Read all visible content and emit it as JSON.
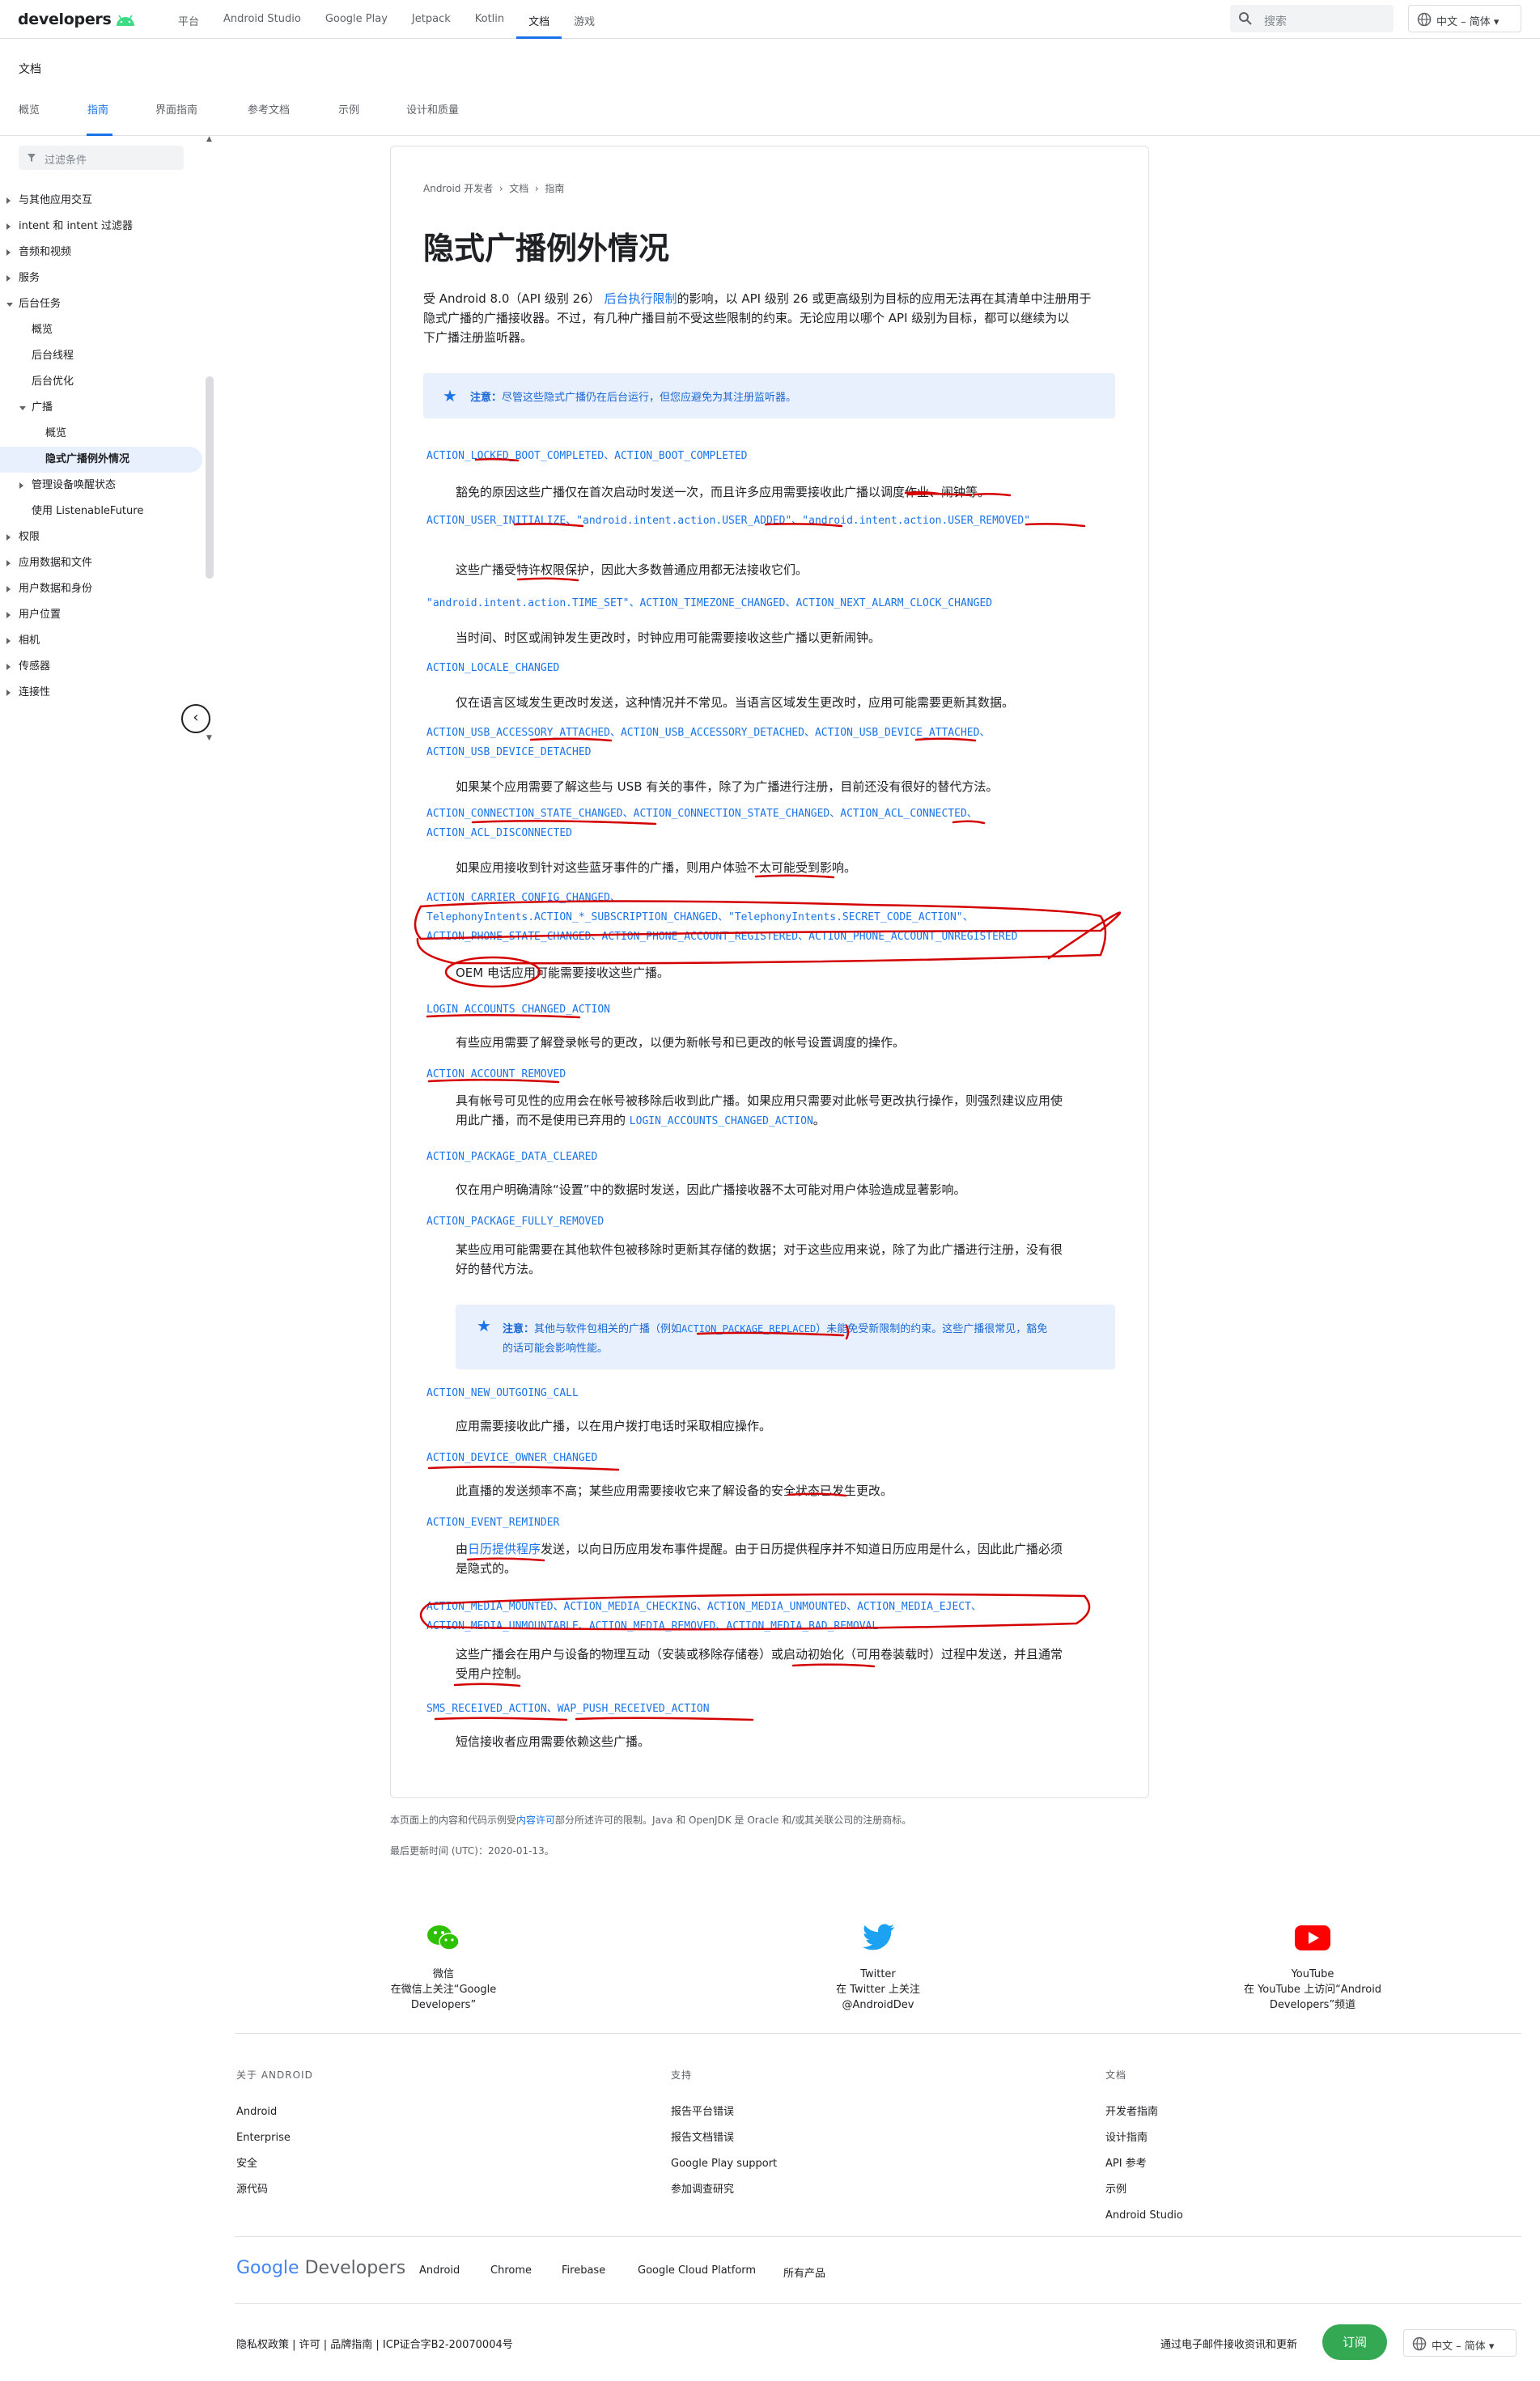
{
  "header": {
    "logo": "developers",
    "nav": [
      "平台",
      "Android Studio",
      "Google Play",
      "Jetpack",
      "Kotlin",
      "文档",
      "游戏"
    ],
    "active_nav": "文档",
    "search_placeholder": "搜索",
    "language": "中文 – 简体"
  },
  "subheader": {
    "title": "文档",
    "tabs": [
      "概览",
      "指南",
      "界面指南",
      "参考文档",
      "示例",
      "设计和质量"
    ],
    "active_tab": "指南"
  },
  "sidebar": {
    "filter_placeholder": "过滤条件",
    "items": [
      {
        "label": "与其他应用交互",
        "level": 0,
        "arrow": "closed"
      },
      {
        "label": "intent 和 intent 过滤器",
        "level": 0,
        "arrow": "closed"
      },
      {
        "label": "音频和视频",
        "level": 0,
        "arrow": "closed"
      },
      {
        "label": "服务",
        "level": 0,
        "arrow": "closed"
      },
      {
        "label": "后台任务",
        "level": 0,
        "arrow": "open"
      },
      {
        "label": "概览",
        "level": 1,
        "arrow": "none"
      },
      {
        "label": "后台线程",
        "level": 1,
        "arrow": "none"
      },
      {
        "label": "后台优化",
        "level": 1,
        "arrow": "none"
      },
      {
        "label": "广播",
        "level": 1,
        "arrow": "open"
      },
      {
        "label": "概览",
        "level": 2,
        "arrow": "none"
      },
      {
        "label": "隐式广播例外情况",
        "level": 2,
        "arrow": "none",
        "selected": true
      },
      {
        "label": "管理设备唤醒状态",
        "level": 1,
        "arrow": "closed"
      },
      {
        "label": "使用 ListenableFuture",
        "level": 1,
        "arrow": "none"
      },
      {
        "label": "权限",
        "level": 0,
        "arrow": "closed"
      },
      {
        "label": "应用数据和文件",
        "level": 0,
        "arrow": "closed"
      },
      {
        "label": "用户数据和身份",
        "level": 0,
        "arrow": "closed"
      },
      {
        "label": "用户位置",
        "level": 0,
        "arrow": "closed"
      },
      {
        "label": "相机",
        "level": 0,
        "arrow": "closed"
      },
      {
        "label": "传感器",
        "level": 0,
        "arrow": "closed"
      },
      {
        "label": "连接性",
        "level": 0,
        "arrow": "closed"
      }
    ]
  },
  "article": {
    "breadcrumb": [
      "Android 开发者",
      "文档",
      "指南"
    ],
    "title": "隐式广播例外情况",
    "intro_1": "受 Android 8.0（API 级别 26）",
    "intro_link": "后台执行限制",
    "intro_2": "的影响，以 API 级别 26 或更高级别为目标的应用无法再在其清单中注册用于",
    "intro_line2": "隐式广播的广播接收器。不过，有几种广播目前不受这些限制的约束。无论应用以哪个 API 级别为目标，都可以继续为以",
    "intro_line3": "下广播注册监听器。",
    "note_label": "注意：",
    "note_text": "尽管这些隐式广播仍在后台运行，但您应避免为其注册监听器。",
    "entries": [
      {
        "codes": "ACTION_LOCKED_BOOT_COMPLETED、ACTION_BOOT_COMPLETED",
        "desc": "豁免的原因这些广播仅在首次启动时发送一次，而且许多应用需要接收此广播以调度作业、闹钟等。"
      },
      {
        "codes": "ACTION_USER_INITIALIZE、\"android.intent.action.USER_ADDED\"、\"android.intent.action.USER_REMOVED\"",
        "desc": "这些广播受特许权限保护，因此大多数普通应用都无法接收它们。"
      },
      {
        "codes": "\"android.intent.action.TIME_SET\"、ACTION_TIMEZONE_CHANGED、ACTION_NEXT_ALARM_CLOCK_CHANGED",
        "desc": "当时间、时区或闹钟发生更改时，时钟应用可能需要接收这些广播以更新闹钟。"
      },
      {
        "codes": "ACTION_LOCALE_CHANGED",
        "desc": "仅在语言区域发生更改时发送，这种情况并不常见。当语言区域发生更改时，应用可能需要更新其数据。"
      },
      {
        "codes_1": "ACTION_USB_ACCESSORY_ATTACHED、ACTION_USB_ACCESSORY_DETACHED、ACTION_USB_DEVICE_ATTACHED、",
        "codes_2": "ACTION_USB_DEVICE_DETACHED",
        "desc": "如果某个应用需要了解这些与 USB 有关的事件，除了为广播进行注册，目前还没有很好的替代方法。"
      },
      {
        "codes_1": "ACTION_CONNECTION_STATE_CHANGED、ACTION_CONNECTION_STATE_CHANGED、ACTION_ACL_CONNECTED、",
        "codes_2": "ACTION_ACL_DISCONNECTED",
        "desc": "如果应用接收到针对这些蓝牙事件的广播，则用户体验不太可能受到影响。"
      },
      {
        "codes_1": "ACTION_CARRIER_CONFIG_CHANGED、",
        "codes_2": "TelephonyIntents.ACTION_*_SUBSCRIPTION_CHANGED、\"TelephonyIntents.SECRET_CODE_ACTION\"、",
        "codes_3": "ACTION_PHONE_STATE_CHANGED、ACTION_PHONE_ACCOUNT_REGISTERED、ACTION_PHONE_ACCOUNT_UNREGISTERED",
        "desc": "OEM 电话应用可能需要接收这些广播。"
      },
      {
        "codes": "LOGIN_ACCOUNTS_CHANGED_ACTION",
        "desc": "有些应用需要了解登录帐号的更改，以便为新帐号和已更改的帐号设置调度的操作。"
      },
      {
        "codes": "ACTION_ACCOUNT_REMOVED",
        "desc_1": "具有帐号可见性的应用会在帐号被移除后收到此广播。如果应用只需要对此帐号更改执行操作，则强烈建议应用使",
        "desc_2a": "用此广播，而不是使用已弃用的",
        "desc_2code": "LOGIN_ACCOUNTS_CHANGED_ACTION",
        "desc_2b": "。"
      },
      {
        "codes": "ACTION_PACKAGE_DATA_CLEARED",
        "desc": "仅在用户明确清除“设置”中的数据时发送，因此广播接收器不太可能对用户体验造成显著影响。"
      },
      {
        "codes": "ACTION_PACKAGE_FULLY_REMOVED",
        "desc_1": "某些应用可能需要在其他软件包被移除时更新其存储的数据；对于这些应用来说，除了为此广播进行注册，没有很",
        "desc_2": "好的替代方法。"
      },
      {
        "codes": "ACTION_NEW_OUTGOING_CALL",
        "desc": "应用需要接收此广播，以在用户拨打电话时采取相应操作。"
      },
      {
        "codes": "ACTION_DEVICE_OWNER_CHANGED",
        "desc": "此直播的发送频率不高；某些应用需要接收它来了解设备的安全状态已发生更改。"
      },
      {
        "codes": "ACTION_EVENT_REMINDER",
        "desc_1a": "由",
        "desc_1link": "日历提供程序",
        "desc_1b": "发送，以向日历应用发布事件提醒。由于日历提供程序并不知道日历应用是什么，因此此广播必须",
        "desc_2": "是隐式的。"
      },
      {
        "codes_1": "ACTION_MEDIA_MOUNTED、ACTION_MEDIA_CHECKING、ACTION_MEDIA_UNMOUNTED、ACTION_MEDIA_EJECT、",
        "codes_2": "ACTION_MEDIA_UNMOUNTABLE、ACTION_MEDIA_REMOVED、ACTION_MEDIA_BAD_REMOVAL",
        "desc_1": "这些广播会在用户与设备的物理互动（安装或移除存储卷）或启动初始化（可用卷装载时）过程中发送，并且通常",
        "desc_2": "受用户控制。"
      },
      {
        "codes": "SMS_RECEIVED_ACTION、WAP_PUSH_RECEIVED_ACTION",
        "desc": "短信接收者应用需要依赖这些广播。"
      }
    ],
    "note2_label": "注意：",
    "note2_text_1a": "其他与软件包相关的广播（例如",
    "note2_code": "ACTION_PACKAGE_REPLACED",
    "note2_text_1b": "）未能免受新限制的约束。这些广播很常见，豁免",
    "note2_text_2": "的话可能会影响性能。"
  },
  "page_footer": {
    "license_a": "本页面上的内容和代码示例受",
    "license_link": "内容许可",
    "license_b": "部分所述许可的限制。Java 和 OpenJDK 是 Oracle 和/或其关联公司的注册商标。",
    "updated": "最后更新时间 (UTC)：2020-01-13。"
  },
  "social": [
    {
      "name": "微信",
      "text_1": "在微信上关注“Google",
      "text_2": "Developers”",
      "icon": "wechat-icon",
      "color": "#2dc100"
    },
    {
      "name": "Twitter",
      "text_1": "在 Twitter 上关注",
      "text_2": "@AndroidDev",
      "icon": "twitter-icon",
      "color": "#1da1f2"
    },
    {
      "name": "YouTube",
      "text_1": "在 YouTube 上访问“Android",
      "text_2": "Developers”频道",
      "icon": "youtube-icon",
      "color": "#ff0000"
    }
  ],
  "footer_cols": [
    {
      "heading": "关于 ANDROID",
      "links": [
        "Android",
        "Enterprise",
        "安全",
        "源代码"
      ]
    },
    {
      "heading": "支持",
      "links": [
        "报告平台错误",
        "报告文档错误",
        "Google Play support",
        "参加调查研究"
      ]
    },
    {
      "heading": "文档",
      "links": [
        "开发者指南",
        "设计指南",
        "API 参考",
        "示例",
        "Android Studio"
      ]
    }
  ],
  "google_dev": {
    "google": "Google",
    "developers": "Developers",
    "links": [
      "Android",
      "Chrome",
      "Firebase",
      "Google Cloud Platform",
      "所有产品"
    ]
  },
  "bottom": {
    "links": "隐私权政策 | 许可 | 品牌指南 | ICP证合字B2-20070004号",
    "subscribe_text": "通过电子邮件接收资讯和更新",
    "subscribe_btn": "订阅",
    "language": "中文 – 简体"
  }
}
